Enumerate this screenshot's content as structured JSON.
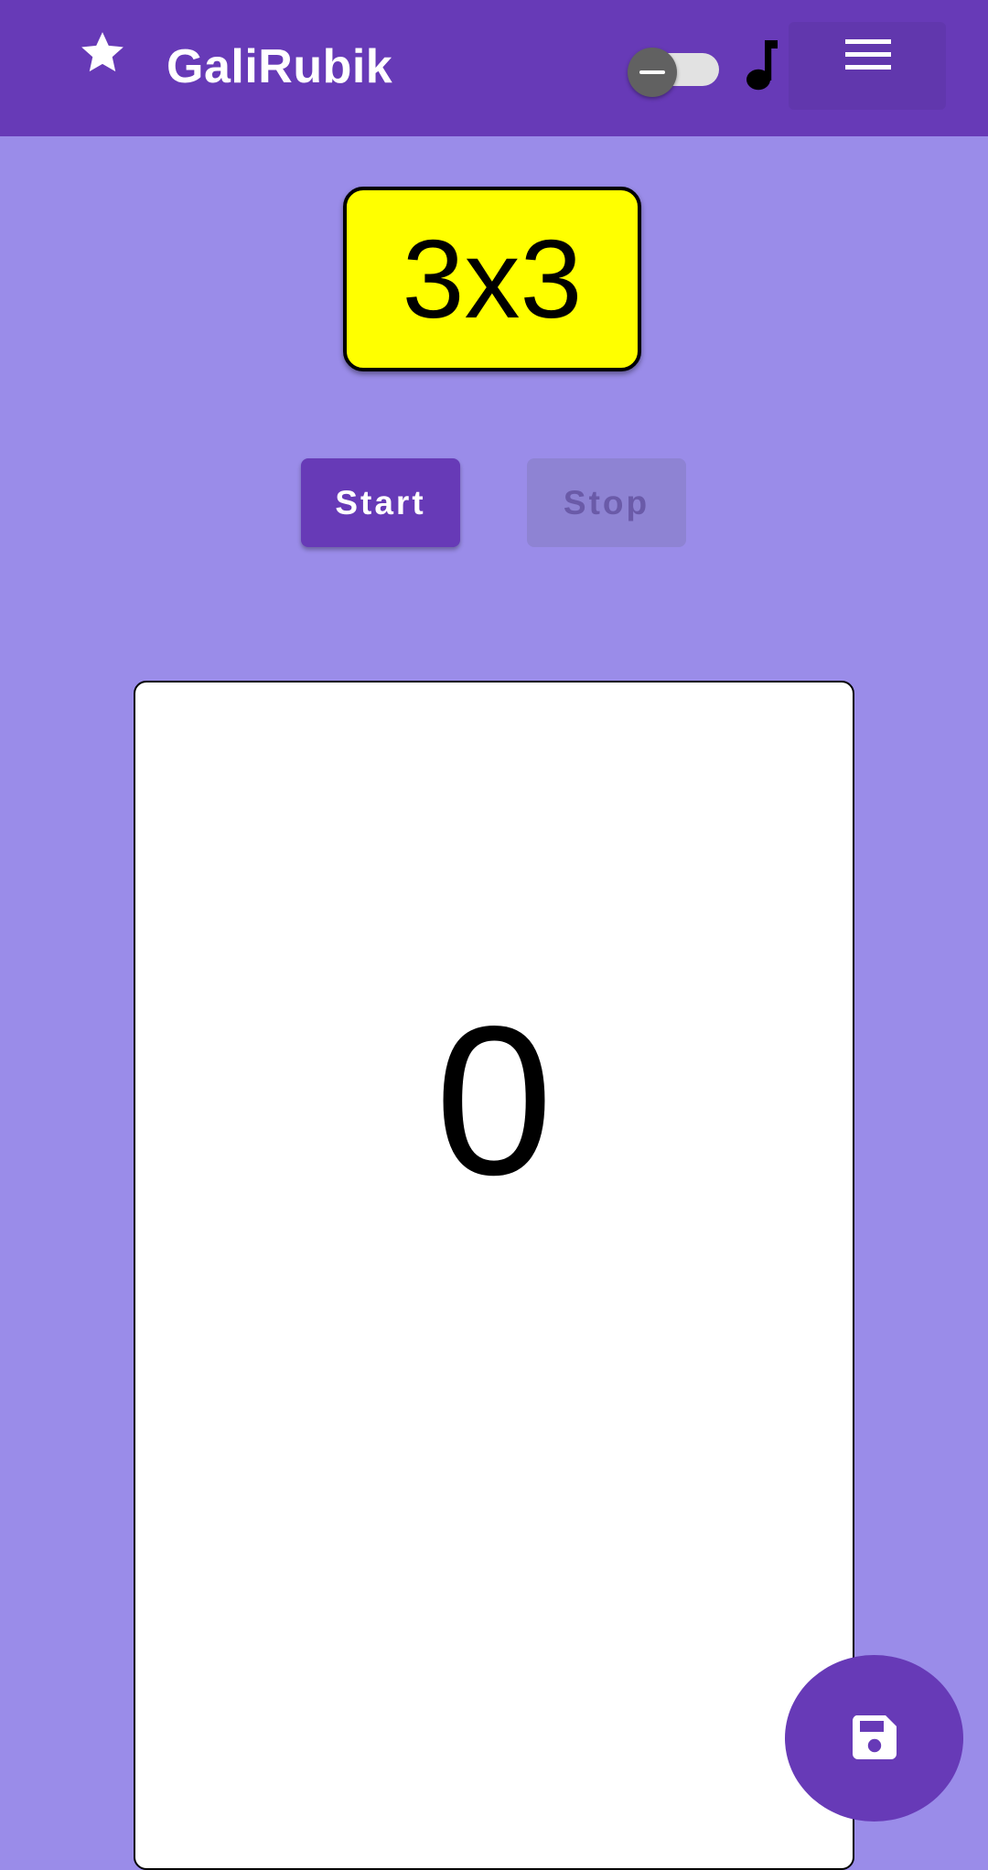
{
  "app_bar": {
    "title": "GaliRubik",
    "icons": {
      "leading": "star-icon",
      "toggle": "theme-toggle",
      "music": "music-note-icon",
      "menu": "menu-icon"
    },
    "toggle_state": "off"
  },
  "puzzle": {
    "label": "3x3"
  },
  "controls": {
    "start_label": "Start",
    "stop_label": "Stop",
    "stop_enabled": false
  },
  "timer": {
    "value": "0"
  },
  "fab": {
    "icon": "save-icon"
  },
  "colors": {
    "primary": "#673ab7",
    "background": "#9a8ce9",
    "badge": "#ffff00",
    "card": "#ffffff"
  }
}
